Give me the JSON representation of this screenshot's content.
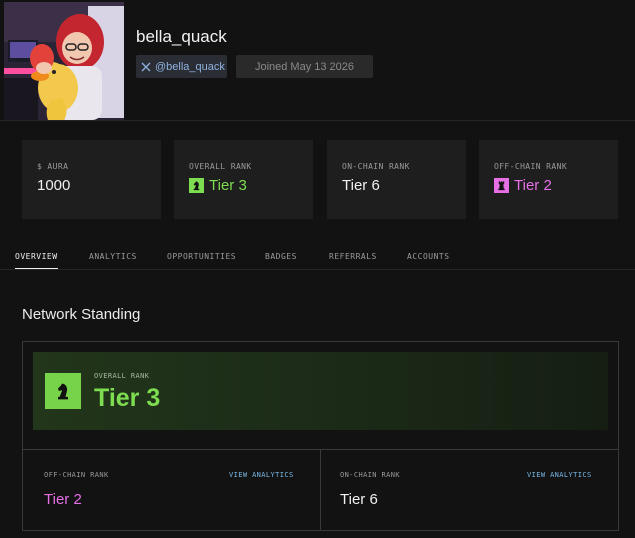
{
  "profile": {
    "username": "bella_quack",
    "handle": "@bella_quack",
    "joined": "Joined May 13 2026"
  },
  "stats": [
    {
      "label": "$ AURA",
      "value": "1000",
      "icon": "",
      "color": "#f0f0f0"
    },
    {
      "label": "OVERALL RANK",
      "value": "Tier 3",
      "icon": "knight-icon",
      "color": "#7ddc4f"
    },
    {
      "label": "ON-CHAIN RANK",
      "value": "Tier 6",
      "icon": "",
      "color": "#f0f0f0"
    },
    {
      "label": "OFF-CHAIN RANK",
      "value": "Tier 2",
      "icon": "rook-icon",
      "color": "#e66fe6"
    }
  ],
  "tabs": [
    "OVERVIEW",
    "ANALYTICS",
    "OPPORTUNITIES",
    "BADGES",
    "REFERRALS",
    "ACCOUNTS"
  ],
  "active_tab": "OVERVIEW",
  "network": {
    "title": "Network Standing",
    "overall_label": "OVERALL RANK",
    "overall_value": "Tier 3",
    "offchain_label": "OFF-CHAIN RANK",
    "offchain_value": "Tier 2",
    "onchain_label": "ON-CHAIN RANK",
    "onchain_value": "Tier 6",
    "link_label": "VIEW ANALYTICS"
  },
  "colors": {
    "accent_green": "#7ddc4f",
    "accent_pink": "#e66fe6",
    "link_blue": "#79b8e6"
  }
}
